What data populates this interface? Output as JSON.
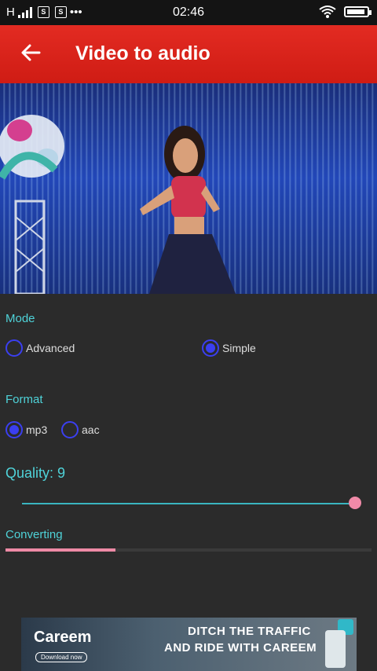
{
  "status_bar": {
    "carrier": "H",
    "sim1": "S",
    "sim2": "S",
    "more": "•••",
    "time": "02:46",
    "icons": [
      "signal-icon",
      "wifi-icon",
      "battery-icon"
    ]
  },
  "app_bar": {
    "title": "Video to audio",
    "back_icon": "arrow-left-icon",
    "background": "#d9221a"
  },
  "mode": {
    "label": "Mode",
    "options": [
      {
        "label": "Advanced",
        "selected": false
      },
      {
        "label": "Simple",
        "selected": true
      }
    ]
  },
  "format": {
    "label": "Format",
    "options": [
      {
        "label": "mp3",
        "selected": true
      },
      {
        "label": "aac",
        "selected": false
      }
    ]
  },
  "quality": {
    "label": "Quality: 9",
    "value": 9,
    "slider_fraction": 1.0
  },
  "converting": {
    "label": "Converting",
    "progress_fraction": 0.3
  },
  "ad": {
    "brand": "Careem",
    "download": "Download now",
    "line1": "DITCH THE TRAFFIC",
    "line2": "AND RIDE WITH CAREEM"
  },
  "colors": {
    "accent_teal": "#4fd3d9",
    "radio_blue": "#3b3ff0",
    "slider_pink": "#f08aa8",
    "background": "#2b2b2b"
  }
}
